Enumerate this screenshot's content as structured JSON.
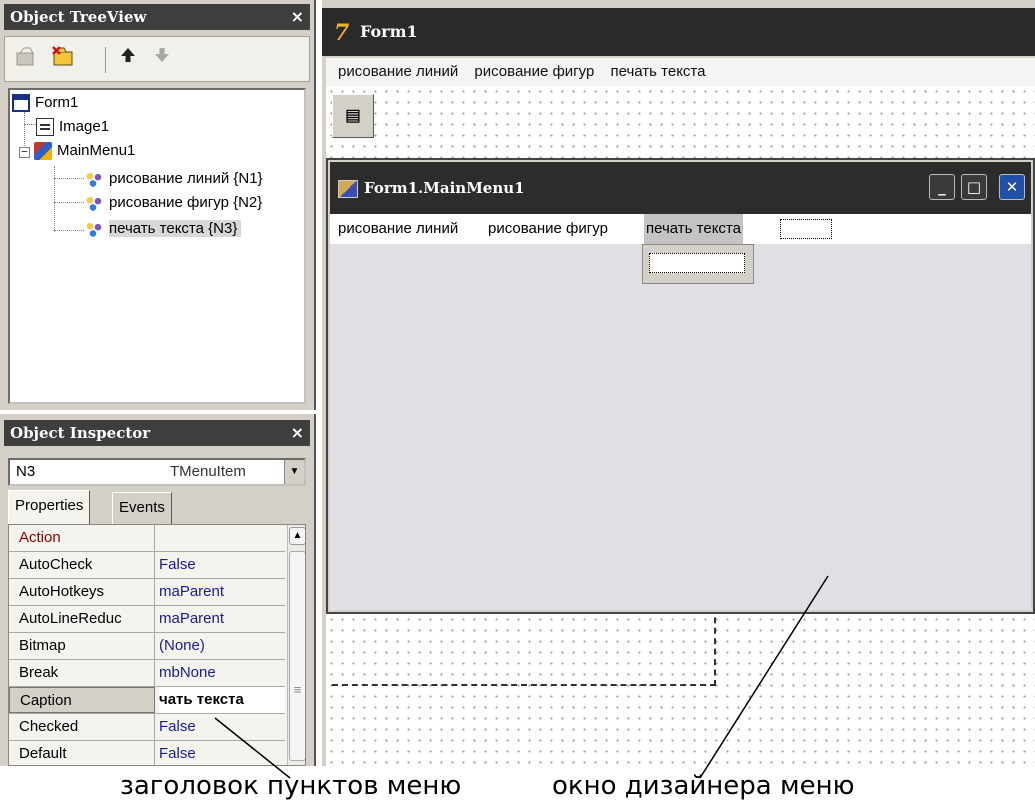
{
  "treeview": {
    "title": "Object TreeView",
    "close_glyph": "×",
    "toolbar_icons": [
      "new-item-icon",
      "delete-item-icon",
      "arrow-up-icon",
      "arrow-down-icon"
    ],
    "nodes": [
      {
        "label": "Form1",
        "icon": "form-icon"
      },
      {
        "label": "Image1",
        "icon": "image-icon"
      },
      {
        "label": "MainMenu1",
        "icon": "mainmenu-icon",
        "expander": "−"
      },
      {
        "label": "рисование линий {N1}",
        "icon": "menuitem-icon"
      },
      {
        "label": "рисование фигур {N2}",
        "icon": "menuitem-icon"
      },
      {
        "label": "печать текста {N3}",
        "icon": "menuitem-icon"
      }
    ]
  },
  "inspector": {
    "title": "Object Inspector",
    "close_glyph": "×",
    "selected_name": "N3",
    "selected_type": "TMenuItem",
    "tabs": [
      "Properties",
      "Events"
    ],
    "properties": [
      {
        "name": "Action",
        "value": ""
      },
      {
        "name": "AutoCheck",
        "value": "False"
      },
      {
        "name": "AutoHotkeys",
        "value": "maParent"
      },
      {
        "name": "AutoLineReduc",
        "value": "maParent"
      },
      {
        "name": "Bitmap",
        "value": "(None)"
      },
      {
        "name": "Break",
        "value": "mbNone"
      },
      {
        "name": "Caption",
        "value": "чать текста"
      },
      {
        "name": "Checked",
        "value": "False"
      },
      {
        "name": "Default",
        "value": "False"
      }
    ],
    "scroll_glyphs": {
      "up": "▲",
      "grip": "≡"
    },
    "combo_arrow": "▼"
  },
  "form1": {
    "title": "Form1",
    "logo_glyph": "7",
    "menu": [
      "рисование линий",
      "рисование фигур",
      "печать текста"
    ],
    "mainmenu_component_glyph": "▤"
  },
  "menu_designer": {
    "title": "Form1.MainMenu1",
    "menu": [
      "рисование линий",
      "рисование фигур",
      "печать текста"
    ],
    "window_buttons": {
      "minimize": "_",
      "maximize": "□",
      "close": "✕"
    }
  },
  "annotations": {
    "left_caption": "заголовок пунктов меню",
    "right_caption": "окно дизайнера меню"
  },
  "colors": {
    "title_bar": "#2a2a2a",
    "panel": "#d4d0c8",
    "property_value": "#1a1a9a",
    "action_property": "#8b0000"
  }
}
